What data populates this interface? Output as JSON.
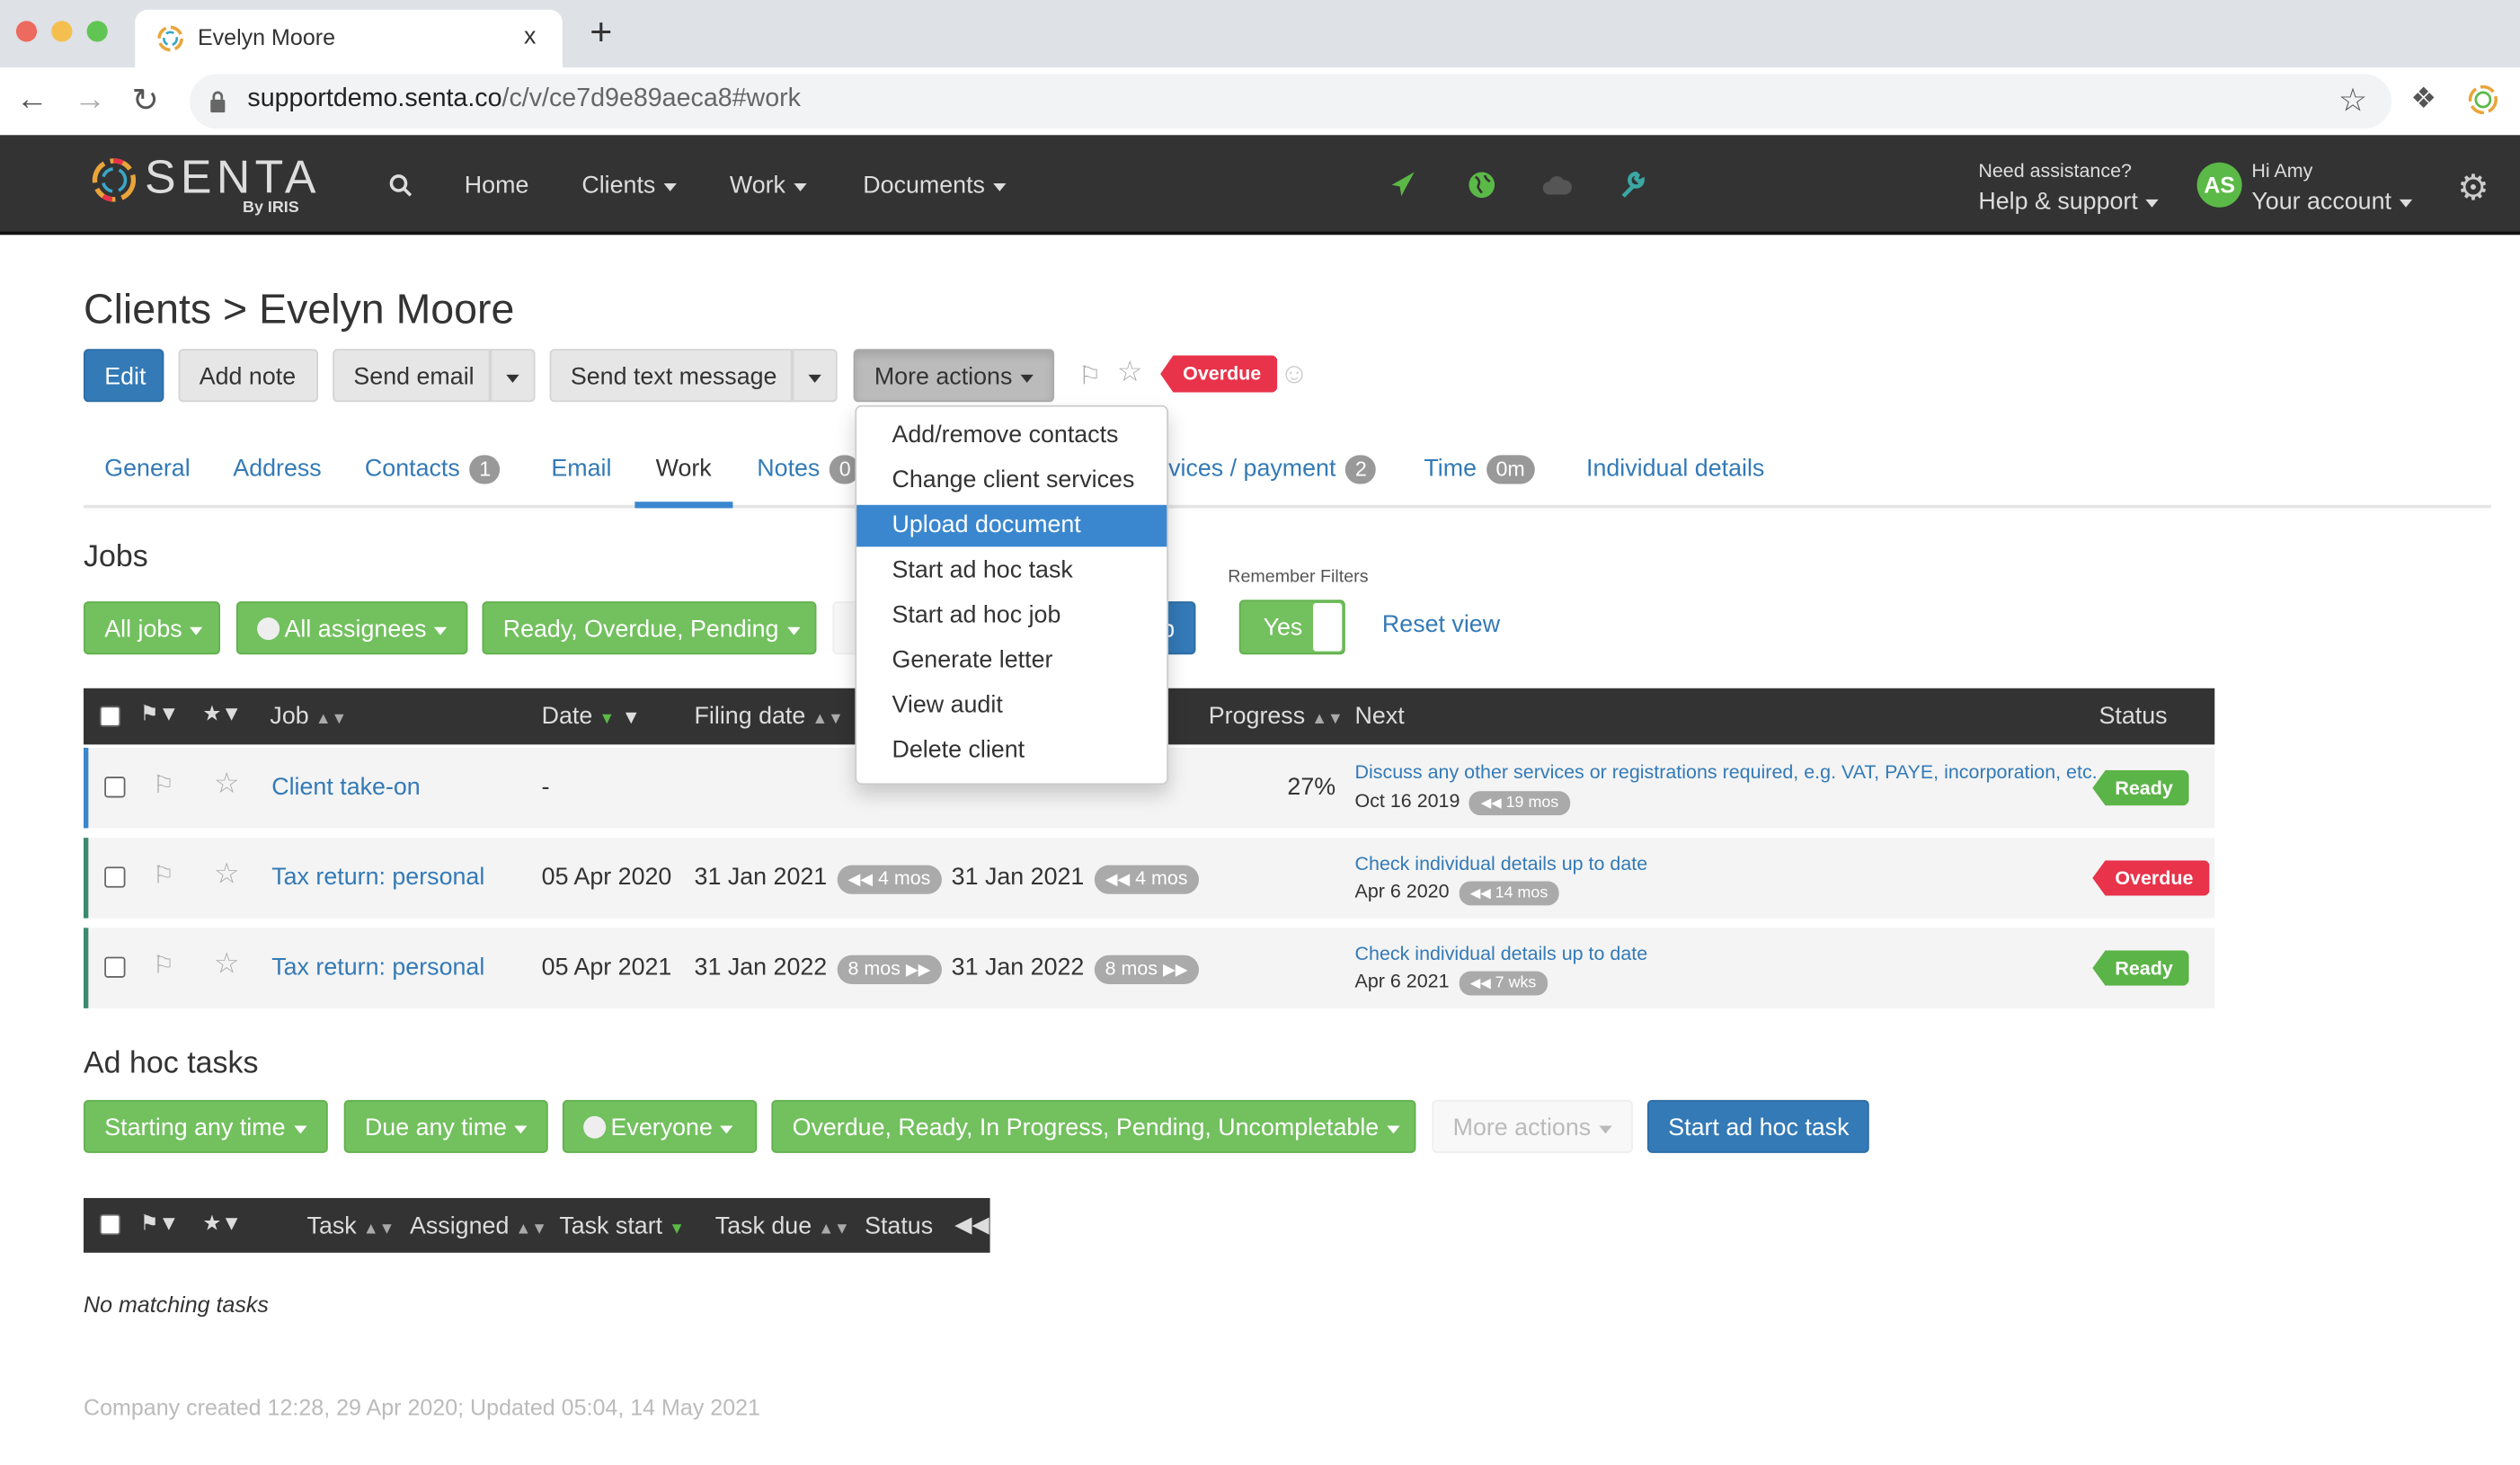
{
  "browser": {
    "tab_title": "Evelyn Moore",
    "tab_close": "x",
    "new_tab": "+",
    "url_host": "supportdemo.senta.co",
    "url_path": "/c/v/ce7d9e89aeca8#work"
  },
  "appbar": {
    "logo": "SENTA By IRIS",
    "nav": [
      {
        "label": "Home"
      },
      {
        "label": "Clients"
      },
      {
        "label": "Work"
      },
      {
        "label": "Documents"
      }
    ],
    "assist_label": "Need assistance?",
    "help_label": "Help & support",
    "greeting": "Hi Amy",
    "avatar_initials": "AS",
    "account_label": "Your account",
    "colors": {
      "green": "#5bb947",
      "teal": "#3aa7a3"
    }
  },
  "page": {
    "breadcrumb": "Clients > Evelyn Moore",
    "actions": {
      "edit": "Edit",
      "add_note": "Add note",
      "send_email": "Send email",
      "send_text": "Send text message",
      "more_actions": "More actions",
      "overdue_tag": "Overdue"
    },
    "tabs": [
      {
        "label": "General"
      },
      {
        "label": "Address"
      },
      {
        "label": "Contacts",
        "badge": "1"
      },
      {
        "label": "Email"
      },
      {
        "label": "Work",
        "active": true
      },
      {
        "label": "Notes",
        "badge": "0"
      },
      {
        "label": "vices / payment",
        "badge": "2"
      },
      {
        "label": "Time",
        "badge": "0m"
      },
      {
        "label": "Individual details"
      }
    ]
  },
  "more_actions_menu": {
    "items": [
      {
        "label": "Add/remove contacts"
      },
      {
        "label": "Change client services"
      },
      {
        "label": "Upload document",
        "highlighted": true
      },
      {
        "label": "Start ad hoc task"
      },
      {
        "label": "Start ad hoc job"
      },
      {
        "label": "Generate letter"
      },
      {
        "label": "View audit"
      },
      {
        "label": "Delete client"
      }
    ]
  },
  "jobs": {
    "heading": "Jobs",
    "filters": {
      "jobs": "All jobs",
      "assignees": "All assignees",
      "statuses": "Ready, Overdue, Pending",
      "hidden_button_tail": "b"
    },
    "remember_filters_label": "Remember Filters",
    "remember_filters_value": "Yes",
    "reset_view": "Reset view",
    "columns": {
      "job": "Job",
      "date": "Date",
      "filing_date": "Filing date",
      "progress": "Progress",
      "next": "Next",
      "status": "Status"
    },
    "rows": [
      {
        "job": "Client take-on",
        "date": "-",
        "filing_date": "",
        "filing_badge": "",
        "second_date": "",
        "second_badge": "",
        "progress": "27%",
        "next": "Discuss any other services or registrations required, e.g. VAT, PAYE, incorporation, etc.",
        "next_date": "Oct 16 2019",
        "next_badge": "19 mos",
        "status": "Ready",
        "status_color": "#5bb447",
        "bar_color": "#3a87cf"
      },
      {
        "job": "Tax return: personal",
        "date": "05 Apr 2020",
        "filing_date": "31 Jan 2021",
        "filing_badge": "4 mos",
        "second_date": "31 Jan 2021",
        "second_badge": "4 mos",
        "progress": "",
        "next": "Check individual details up to date",
        "next_date": "Apr 6 2020",
        "next_badge": "14 mos",
        "status": "Overdue",
        "status_color": "#e8334a",
        "bar_color": "#3a8a70"
      },
      {
        "job": "Tax return: personal",
        "date": "05 Apr 2021",
        "filing_date": "31 Jan 2022",
        "filing_badge": "8 mos",
        "second_date": "31 Jan 2022",
        "second_badge": "8 mos",
        "progress": "",
        "next": "Check individual details up to date",
        "next_date": "Apr 6 2021",
        "next_badge": "7 wks",
        "status": "Ready",
        "status_color": "#5bb447",
        "bar_color": "#3a8a70"
      }
    ]
  },
  "adhoc": {
    "heading": "Ad hoc tasks",
    "filters": {
      "start": "Starting any time",
      "due": "Due any time",
      "who": "Everyone",
      "statuses": "Overdue, Ready, In Progress, Pending, Uncompletable"
    },
    "more_actions": "More actions",
    "start_task": "Start ad hoc task",
    "columns": {
      "task": "Task",
      "assigned": "Assigned",
      "task_start": "Task start",
      "task_due": "Task due",
      "status": "Status"
    },
    "empty": "No matching tasks"
  },
  "footer": "Company created 12:28, 29 Apr 2020; Updated 05:04, 14 May 2021"
}
